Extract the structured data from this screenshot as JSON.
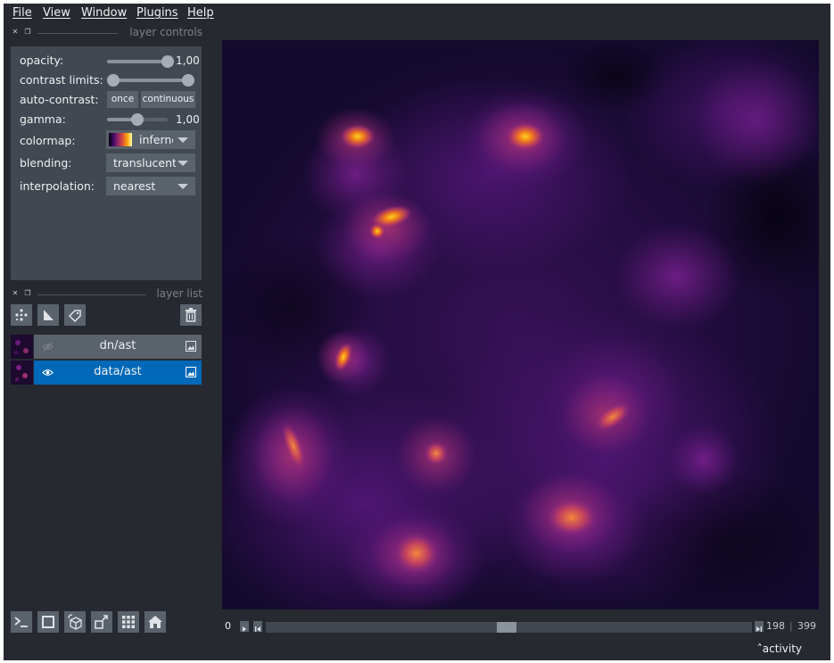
{
  "menu": [
    "File",
    "View",
    "Window",
    "Plugins",
    "Help"
  ],
  "dock_headers": {
    "controls": "layer controls",
    "list": "layer list"
  },
  "controls": {
    "opacity": {
      "label": "opacity:",
      "value": "1,00",
      "level": 1.0
    },
    "contrast_limits": {
      "label": "contrast limits:",
      "range": [
        0.0,
        1.0
      ]
    },
    "auto_contrast": {
      "label": "auto-contrast:",
      "once": "once",
      "continuous": "continuous"
    },
    "gamma": {
      "label": "gamma:",
      "value": "1,00",
      "level": 0.5
    },
    "colormap": {
      "label": "colormap:",
      "value": "inferno"
    },
    "blending": {
      "label": "blending:",
      "value": "translucent"
    },
    "interpolation": {
      "label": "interpolation:",
      "value": "nearest"
    }
  },
  "layer_tools": [
    "points-icon",
    "shapes-icon",
    "labels-icon",
    "delete-icon"
  ],
  "layers": [
    {
      "name": "dn/ast",
      "visible": false,
      "selected": false
    },
    {
      "name": "data/ast",
      "visible": true,
      "selected": true
    }
  ],
  "bottom_buttons": [
    "console-icon",
    "ndisplay-icon",
    "roll-dims-icon",
    "transpose-icon",
    "grid-icon",
    "home-icon"
  ],
  "dims": {
    "axis": "0",
    "current": "198",
    "total": "399",
    "position": 0.496
  },
  "activity": "activity",
  "colors": {
    "background": "#262930",
    "panel": "#414851",
    "selected": "#0068b8",
    "accent": "#5a626c"
  }
}
